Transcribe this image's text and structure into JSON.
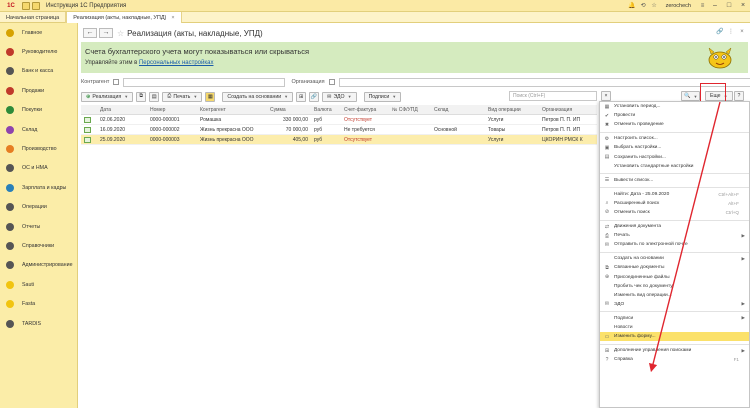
{
  "window": {
    "app_title": "Инструкция 1С Предприятия",
    "logo": "1С",
    "user": "zerochech"
  },
  "tabs": [
    {
      "label": "Начальная страница"
    },
    {
      "label": "Реализация (акты, накладные, УПД)"
    }
  ],
  "sidebar": {
    "items": [
      {
        "label": "Главное",
        "icon": "home-icon"
      },
      {
        "label": "Руководителю",
        "icon": "chart-icon"
      },
      {
        "label": "Банк и касса",
        "icon": "bank-icon"
      },
      {
        "label": "Продажи",
        "icon": "cart-icon"
      },
      {
        "label": "Покупки",
        "icon": "basket-icon"
      },
      {
        "label": "Склад",
        "icon": "warehouse-icon"
      },
      {
        "label": "Производство",
        "icon": "factory-icon"
      },
      {
        "label": "ОС и НМА",
        "icon": "assets-icon"
      },
      {
        "label": "Зарплата и кадры",
        "icon": "people-icon"
      },
      {
        "label": "Операции",
        "icon": "operations-icon"
      },
      {
        "label": "Отчеты",
        "icon": "reports-icon"
      },
      {
        "label": "Справочники",
        "icon": "book-icon"
      },
      {
        "label": "Администрирование",
        "icon": "gear-icon"
      },
      {
        "label": "Sauti",
        "icon": "app-icon"
      },
      {
        "label": "Fasta",
        "icon": "app-icon"
      },
      {
        "label": "TARDIS",
        "icon": "app-icon"
      }
    ]
  },
  "header": {
    "title": "Реализация (акты, накладные, УПД)"
  },
  "banner": {
    "line1": "Счета бухгалтерского учета могут показываться или скрываться",
    "line2_prefix": "Управляйте этим в",
    "link": "Персональных настройках"
  },
  "filters": {
    "counterparty_label": "Контрагент",
    "organization_label": "Организация"
  },
  "toolbar": {
    "add_label": "Реализация",
    "print_label": "Печать",
    "create_based_label": "Создать на основании",
    "edo_label": "ЭДО",
    "signatures_label": "Подписи",
    "search_placeholder": "Поиск (Ctrl+F)",
    "more_label": "Еще"
  },
  "table": {
    "columns": [
      "Дата",
      "Номер",
      "Контрагент",
      "Сумма",
      "Валюта",
      "Счет-фактура",
      "№ СФ/УПД",
      "Склад",
      "Вид операции",
      "Организация"
    ],
    "rows": [
      {
        "date": "02.06.2020",
        "number": "0000-000001",
        "counterparty": "Ромашка",
        "sum": "330 000,00",
        "currency": "руб",
        "invoice": "Отсутствует",
        "sf_num": "",
        "warehouse": "",
        "op_type": "Услуги",
        "org": "Петров П. П. ИП"
      },
      {
        "date": "16.09.2020",
        "number": "0000-000002",
        "counterparty": "Жизнь прекрасна ООО",
        "sum": "70 000,00",
        "currency": "руб",
        "invoice": "Не требуется",
        "sf_num": "",
        "warehouse": "Основной",
        "op_type": "Товары",
        "org": "Петров П. П. ИП"
      },
      {
        "date": "25.09.2020",
        "number": "0000-000003",
        "counterparty": "Жизнь прекрасна ООО",
        "sum": "405,00",
        "currency": "руб",
        "invoice": "Отсутствует",
        "sf_num": "",
        "warehouse": "",
        "op_type": "Услуги",
        "org": "ЦКОРИН РМСК К"
      }
    ]
  },
  "menu": {
    "items": [
      {
        "label": "Установить период...",
        "icon": "calendar-icon",
        "shortcut": ""
      },
      {
        "label": "Провести",
        "icon": "post-icon",
        "shortcut": ""
      },
      {
        "label": "Отменить проведение",
        "icon": "unpost-icon",
        "shortcut": ""
      },
      {
        "sep": true
      },
      {
        "label": "Настроить список...",
        "icon": "settings-icon",
        "shortcut": ""
      },
      {
        "label": "Выбрать настройки...",
        "icon": "folder-icon",
        "shortcut": ""
      },
      {
        "label": "Сохранить настройки...",
        "icon": "save-icon",
        "shortcut": ""
      },
      {
        "label": "Установить стандартные настройки",
        "icon": "",
        "shortcut": ""
      },
      {
        "sep": true
      },
      {
        "label": "Вывести список...",
        "icon": "list-icon",
        "shortcut": ""
      },
      {
        "sep": true
      },
      {
        "label": "Найти: Дата - 25.09.2020",
        "icon": "",
        "shortcut": "Ctrl+Alt+F"
      },
      {
        "label": "Расширенный поиск",
        "icon": "search-icon",
        "shortcut": "Alt+F"
      },
      {
        "label": "Отменить поиск",
        "icon": "cancel-search-icon",
        "shortcut": "Ctrl+Q"
      },
      {
        "sep": true
      },
      {
        "label": "Движения документа",
        "icon": "movement-icon",
        "shortcut": ""
      },
      {
        "label": "Печать",
        "icon": "print-icon",
        "shortcut": "",
        "submenu": true
      },
      {
        "label": "Отправить по электронной почте",
        "icon": "mail-icon",
        "shortcut": ""
      },
      {
        "sep": true
      },
      {
        "label": "Создать на основании",
        "icon": "",
        "shortcut": "",
        "submenu": true
      },
      {
        "label": "Связанные документы",
        "icon": "linked-icon",
        "shortcut": ""
      },
      {
        "label": "Присоединенные файлы",
        "icon": "attach-icon",
        "shortcut": ""
      },
      {
        "label": "Пробить чек по документу",
        "icon": "",
        "shortcut": ""
      },
      {
        "label": "Изменить вид операции...",
        "icon": "",
        "shortcut": ""
      },
      {
        "label": "ЭДО",
        "icon": "edo-icon",
        "shortcut": "",
        "submenu": true
      },
      {
        "sep": true
      },
      {
        "label": "Подписи",
        "icon": "",
        "shortcut": "",
        "submenu": true
      },
      {
        "label": "Новости",
        "icon": "",
        "shortcut": ""
      },
      {
        "label": "Изменить форму...",
        "icon": "form-icon",
        "shortcut": "",
        "highlight": true
      },
      {
        "sep": true
      },
      {
        "label": "Дополнение управления поисками",
        "icon": "addon-icon",
        "shortcut": "",
        "submenu": true
      },
      {
        "label": "Справка",
        "icon": "help-icon",
        "shortcut": "F1"
      }
    ]
  },
  "colors": {
    "accent": "#fbe16a",
    "banner": "#d5ebbf",
    "sidebar": "#fbeda8",
    "arrow": "#e0262f"
  }
}
